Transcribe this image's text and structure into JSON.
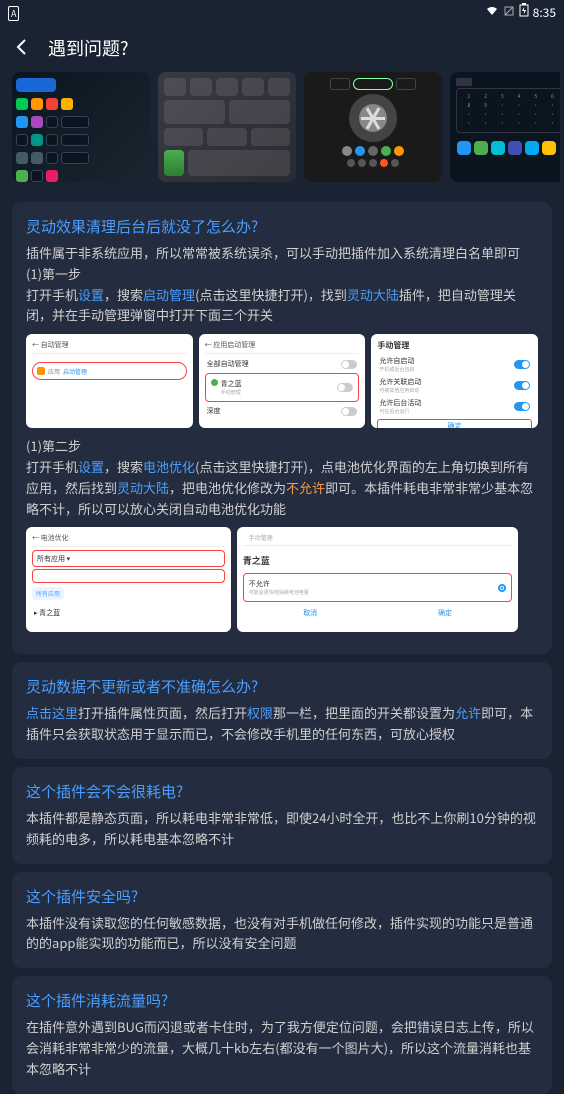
{
  "status": {
    "app_indicator": "A",
    "time": "8:35"
  },
  "header": {
    "title": "遇到问题?"
  },
  "section1": {
    "title": "灵动效果清理后台后就没了怎么办?",
    "intro": "插件属于非系统应用，所以常常被系统误杀，可以手动把插件加入系统清理白名单即可",
    "step1_label": "(1)第一步",
    "step1_prefix": "打开手机",
    "step1_link1": "设置",
    "step1_mid1": "，搜索",
    "step1_link2": "启动管理",
    "step1_mid2": "(点击这里快捷打开)，找到",
    "step1_link3": "灵动大陆",
    "step1_suffix": "插件，把自动管理关闭，并在手动管理弹窗中打开下面三个开关",
    "step2_label": "(1)第二步",
    "step2_prefix": "打开手机",
    "step2_link1": "设置",
    "step2_mid1": "，搜索",
    "step2_link2": "电池优化",
    "step2_mid2": "(点击这里快捷打开)，点电池优化界面的左上角切换到所有应用，然后找到",
    "step2_link3": "灵动大陆",
    "step2_mid3": "，把电池优化修改为",
    "step2_orange": "不允许",
    "step2_suffix": "即可。本插件耗电非常非常少基本忽略不计，所以可以放心关闭自动电池优化功能"
  },
  "shot1a": {
    "header": "← 自动管理",
    "result_label": "应用",
    "result_link": "启动管理"
  },
  "shot1b": {
    "header": "← 应用启动管理",
    "row1": "全部自动管理",
    "app_name": "青之蓝",
    "app_sub": "手动管理",
    "row3": "深度"
  },
  "shot1c": {
    "title": "手动管理",
    "row1": "允许自启动",
    "row1_sub": "开机或后台自启",
    "row2": "允许关联启动",
    "row2_sub": "可被其他应用启动",
    "row3": "允许后台活动",
    "row3_sub": "可在后台运行",
    "confirm": "确定"
  },
  "shot2a": {
    "header": "← 电池优化",
    "dropdown": "所有应用 ▾",
    "pill": "所有应用",
    "app": "青之蓝"
  },
  "shot2b": {
    "header_sub": "手动管理",
    "title": "青之蓝",
    "option": "不允许",
    "option_sub": "可能会更快地消耗电池电量",
    "cancel": "取消",
    "confirm": "确定"
  },
  "section2": {
    "title": "灵动数据不更新或者不准确怎么办?",
    "link1": "点击这里",
    "mid1": "打开插件属性页面，然后打开",
    "link2": "权限",
    "mid2": "那一栏，把里面的开关都设置为",
    "link3": "允许",
    "suffix": "即可，本插件只会获取状态用于显示而已，不会修改手机里的任何东西，可放心授权"
  },
  "section3": {
    "title": "这个插件会不会很耗电?",
    "text": "本插件都是静态页面，所以耗电非常非常低，即使24小时全开，也比不上你刷10分钟的视频耗的电多，所以耗电基本忽略不计"
  },
  "section4": {
    "title": "这个插件安全吗?",
    "text": "本插件没有读取您的任何敏感数据，也没有对手机做任何修改，插件实现的功能只是普通的的app能实现的功能而已，所以没有安全问题"
  },
  "section5": {
    "title": "这个插件消耗流量吗?",
    "text": "在插件意外遇到BUG而闪退或者卡住时，为了我方便定位问题，会把错误日志上传，所以会消耗非常非常少的流量，大概几十kb左右(都没有一个图片大)，所以这个流量消耗也基本忽略不计"
  }
}
